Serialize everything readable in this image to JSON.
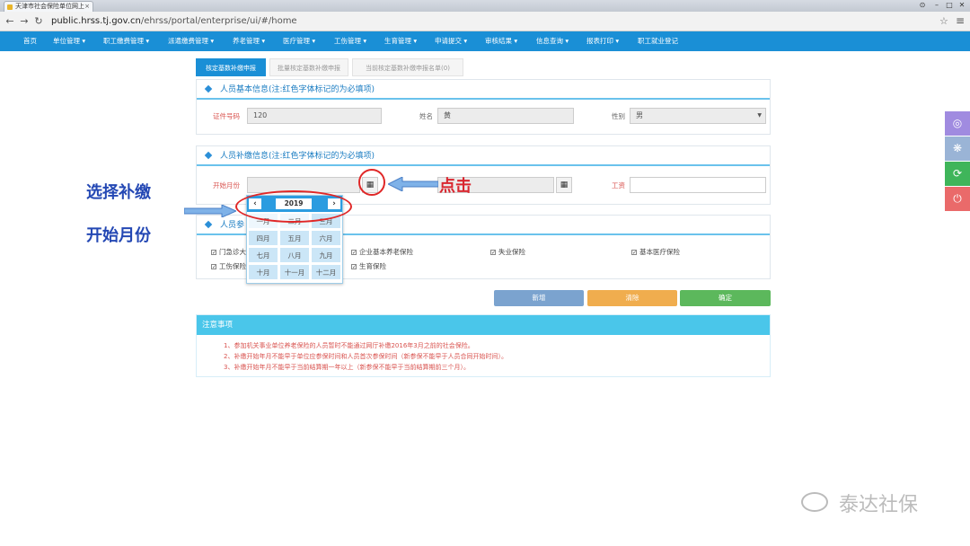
{
  "browser": {
    "tab_title": "天津市社会保险单位网上",
    "url_host": "public.hrss.tj.gov.cn",
    "url_path": "/ehrss/portal/enterprise/ui/#/home"
  },
  "nav": [
    "首页",
    "单位管理 ▾",
    "职工缴费管理 ▾",
    "派遣缴费管理 ▾",
    "养老管理 ▾",
    "医疗管理 ▾",
    "工伤管理 ▾",
    "生育管理 ▾",
    "申请提交 ▾",
    "审核结果 ▾",
    "信息查询 ▾",
    "报表打印 ▾",
    "职工就业登记"
  ],
  "tabs": [
    "核定基数补缴申报",
    "批量核定基数补缴申报",
    "当前核定基数补缴申报名单(0)"
  ],
  "basic": {
    "title": "人员基本信息(注:红色字体标记的为必填项)",
    "id_label": "证件号码",
    "id_value": "120",
    "name_label": "姓名",
    "name_value": "黄",
    "gender_label": "性别",
    "gender_value": "男"
  },
  "supp": {
    "title": "人员补缴信息(注:红色字体标记的为必填项)",
    "start_label": "开始月份",
    "wage_label": "工资"
  },
  "calendar": {
    "year": "2019",
    "prev": "‹",
    "next": "›",
    "months": [
      "一月",
      "二月",
      "三月",
      "四月",
      "五月",
      "六月",
      "七月",
      "八月",
      "九月",
      "十月",
      "十一月",
      "十二月"
    ]
  },
  "insurance": {
    "title_visible": "人员参",
    "items": [
      "门急诊大",
      "企业基本养老保险",
      "失业保险",
      "基本医疗保险",
      "工伤保险",
      "生育保险"
    ]
  },
  "buttons": {
    "add": "新增",
    "clear": "清除",
    "confirm": "确定"
  },
  "notice": {
    "title": "注意事项",
    "lines": [
      "1、参加机关事业单位养老保险的人员暂时不能通过网厅补缴2016年3月之前的社会保险。",
      "2、补缴开始年月不能早于单位应参保时间和人员首次参保时间（新参保不能早于人员合同开始时间）。",
      "3、补缴开始年月不能早于当前结算期一年以上（新参保不能早于当前结算期前三个月）。"
    ]
  },
  "annotations": {
    "left_line1": "选择补缴",
    "left_line2": "开始月份",
    "click": "点击"
  },
  "watermark": "泰达社保",
  "colors": {
    "nav": "#1a8fd6",
    "accent": "#6ac2ec",
    "add": "#7ba3cf",
    "clear": "#f0ad4e",
    "confirm": "#5cb85c",
    "annot_blue": "#2448b4",
    "annot_red": "#d9262f"
  }
}
